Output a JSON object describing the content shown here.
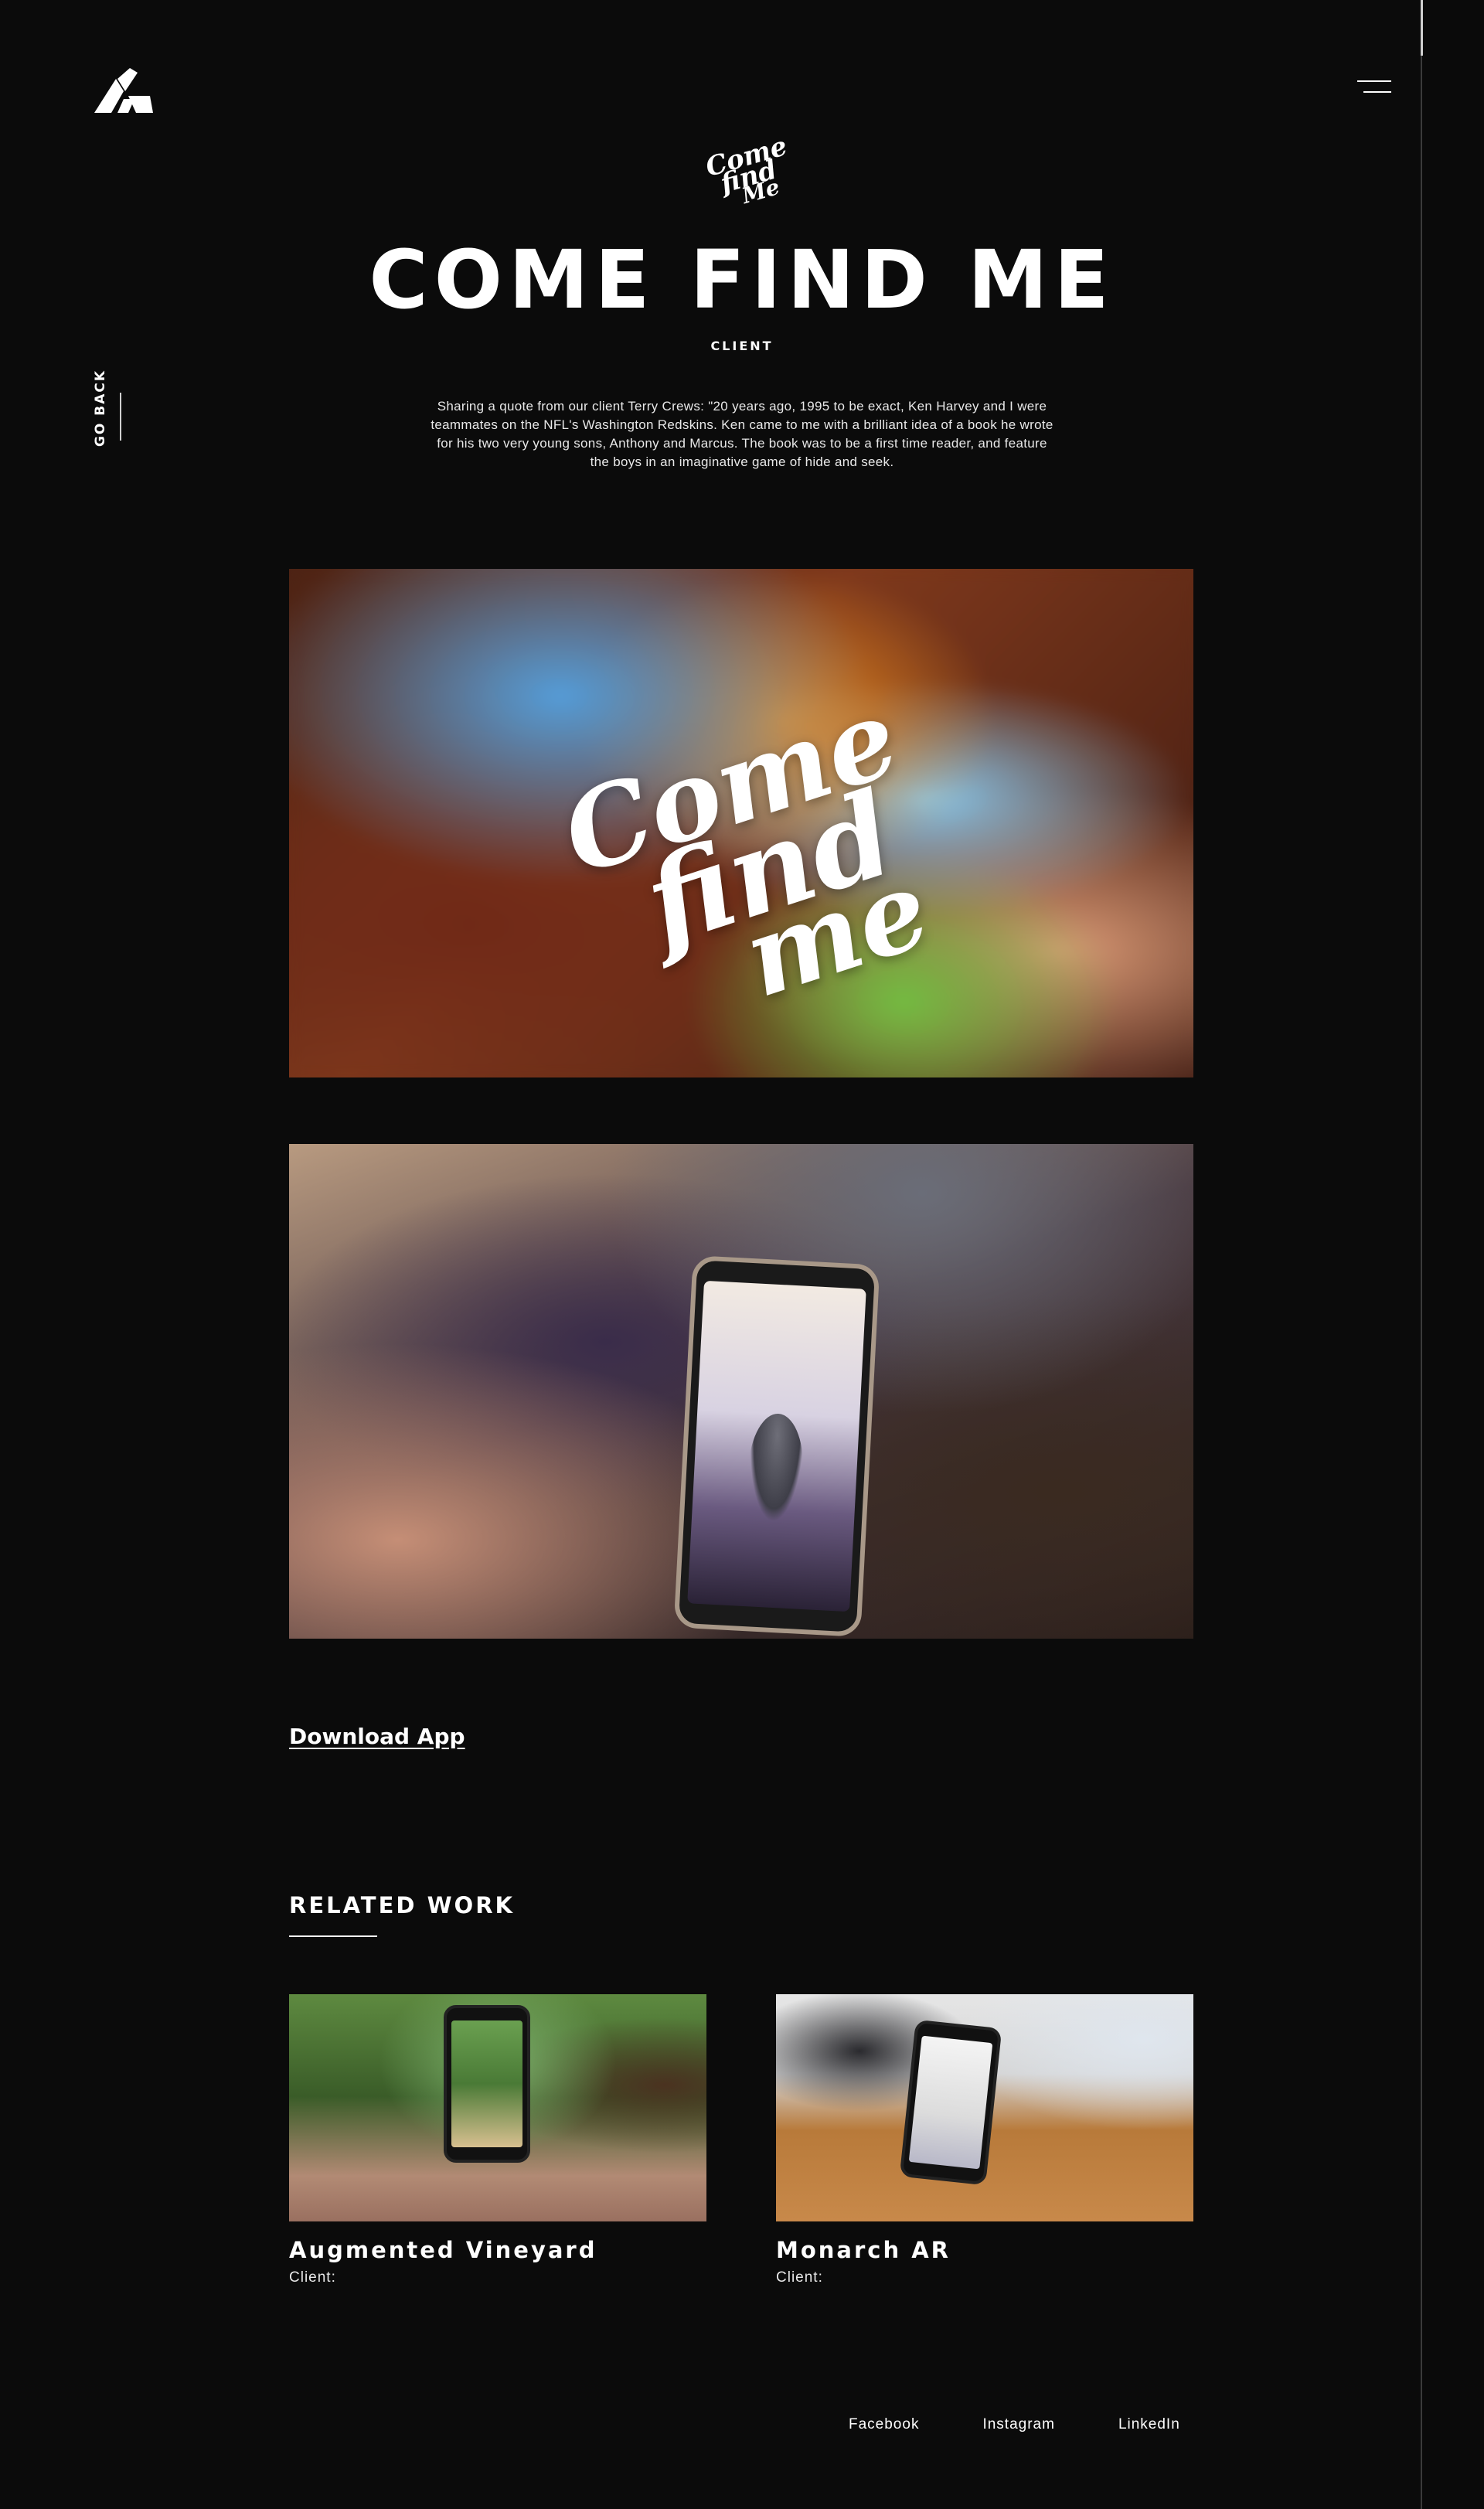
{
  "brand": {
    "logo_icon": "brand-logo-icon"
  },
  "nav": {
    "menu_icon": "hamburger-icon",
    "go_back_label": "GO BACK"
  },
  "hero": {
    "script_logo": [
      "Come",
      "find",
      "Me"
    ],
    "title": "COME FIND ME",
    "client_label": "CLIENT",
    "intro": "Sharing a quote from our client Terry Crews: \"20 years ago, 1995 to be exact, Ken Harvey and I were teammates on the NFL's Washington Redskins. Ken came to me with a brilliant idea of a book he wrote for his two very young sons, Anthony and Marcus. The book was to be a first time reader, and feature the boys in an imaginative game of hide and seek."
  },
  "media": {
    "banner_logo": [
      "Come",
      "find",
      "me"
    ]
  },
  "download": {
    "label": "Download App"
  },
  "related": {
    "title": "RELATED WORK",
    "items": [
      {
        "title": "Augmented Vineyard",
        "client": "Client:"
      },
      {
        "title": "Monarch AR",
        "client": "Client:"
      }
    ]
  },
  "footer": {
    "links": [
      "Facebook",
      "Instagram",
      "LinkedIn"
    ]
  },
  "colors": {
    "background": "#0b0b0b",
    "text": "#ffffff",
    "scrollbar_thumb": "#d0d0d0"
  }
}
